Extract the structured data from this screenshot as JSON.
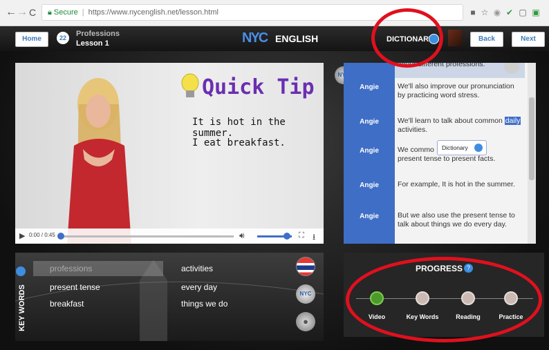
{
  "browser": {
    "secure_label": "Secure",
    "url": "https://www.nycenglish.net/lesson.html"
  },
  "header": {
    "home_label": "Home",
    "lesson_number": "22",
    "lesson_title": "Professions",
    "lesson_subtitle": "Lesson 1",
    "logo_mark": "NYC",
    "logo_text": "ENGLISH",
    "dictionary_label": "DICTIONARY",
    "back_label": "Back",
    "next_label": "Next"
  },
  "video": {
    "quick_tip_title": "Quick Tip",
    "tip_line1": "It is hot in the summer.",
    "tip_line2": "I eat breakfast.",
    "time": "0:00 / 0:45",
    "progress_fraction": 0.0,
    "volume_fraction": 0.75
  },
  "transcript": {
    "rows": [
      {
        "speaker": "",
        "text": "about different professions."
      },
      {
        "speaker": "Angie",
        "text": "We'll also improve our pronunciation by practicing word stress."
      },
      {
        "speaker": "Angie",
        "text_before": "We'll learn to talk about common ",
        "highlight": "daily",
        "text_after": " activities."
      },
      {
        "speaker": "Angie",
        "text": "We commo... present tense to present facts."
      },
      {
        "speaker": "Angie",
        "text": "For example, It is hot in the summer."
      },
      {
        "speaker": "Angie",
        "text": "But we also use the present tense to talk about things we do every day."
      }
    ],
    "tooltip_label": "Dictionary",
    "row4_visible_start": "We commo",
    "row4_visible_end": "present tense to present facts."
  },
  "keywords": {
    "title": "KEY WORDS",
    "col1": [
      "professions",
      "present tense",
      "breakfast"
    ],
    "col2": [
      "activities",
      "every day",
      "things we do"
    ]
  },
  "progress": {
    "title": "PROGRESS",
    "steps": [
      {
        "label": "Video",
        "state": "complete"
      },
      {
        "label": "Key Words",
        "state": "pending"
      },
      {
        "label": "Reading",
        "state": "pending"
      },
      {
        "label": "Practice",
        "state": "pending"
      }
    ]
  },
  "colors": {
    "accent_blue": "#3f6ec7",
    "annotation_red": "#e0101e",
    "progress_green": "#4c9a2a"
  }
}
